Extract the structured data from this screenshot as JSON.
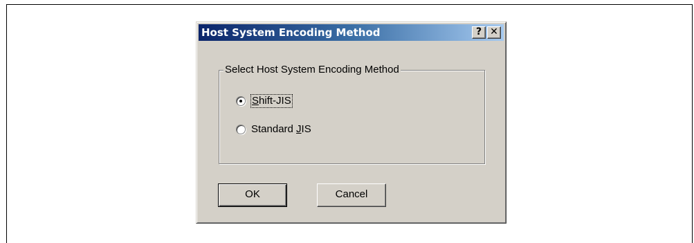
{
  "dialog": {
    "title": "Host System Encoding Method",
    "help_button": "?",
    "close_button": "✕",
    "group": {
      "legend": "Select Host System Encoding Method",
      "options": [
        {
          "label_pre": "",
          "label_mnemonic": "S",
          "label_post": "hift-JIS",
          "selected": true
        },
        {
          "label_pre": "Standard ",
          "label_mnemonic": "J",
          "label_post": "IS",
          "selected": false
        }
      ]
    },
    "ok_label": "OK",
    "cancel_label": "Cancel"
  }
}
